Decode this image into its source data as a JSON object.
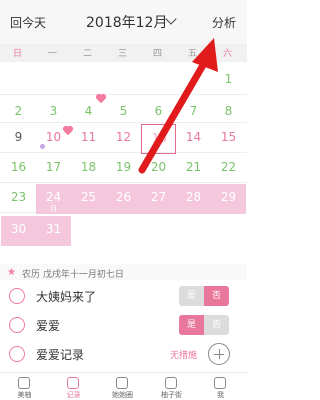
{
  "header": {
    "left_label": "回今天",
    "title": "2018年12月",
    "right_label": "分析"
  },
  "weekdays": [
    "日",
    "一",
    "二",
    "三",
    "四",
    "五",
    "六"
  ],
  "calendar": {
    "rows": [
      [
        {
          "label": "",
          "style": "empty"
        },
        {
          "label": "",
          "style": "empty"
        },
        {
          "label": "",
          "style": "empty"
        },
        {
          "label": "",
          "style": "empty"
        },
        {
          "label": "",
          "style": "empty"
        },
        {
          "label": "",
          "style": "empty"
        },
        {
          "label": "1",
          "style": "green"
        }
      ],
      [
        {
          "label": "2",
          "style": "green"
        },
        {
          "label": "3",
          "style": "green"
        },
        {
          "label": "4",
          "style": "green"
        },
        {
          "label": "5",
          "style": "green"
        },
        {
          "label": "6",
          "style": "green"
        },
        {
          "label": "7",
          "style": "green"
        },
        {
          "label": "8",
          "style": "green"
        }
      ],
      [
        {
          "label": "9",
          "style": "gray"
        },
        {
          "label": "10",
          "style": "pinktext"
        },
        {
          "label": "11",
          "style": "pinktext"
        },
        {
          "label": "12",
          "style": "pinktext"
        },
        {
          "label": "13",
          "style": "pinklight"
        },
        {
          "label": "14",
          "style": "pinktext"
        },
        {
          "label": "15",
          "style": "pinktext"
        }
      ],
      [
        {
          "label": "16",
          "style": "green"
        },
        {
          "label": "17",
          "style": "green"
        },
        {
          "label": "18",
          "style": "green"
        },
        {
          "label": "19",
          "style": "green"
        },
        {
          "label": "20",
          "style": "green"
        },
        {
          "label": "21",
          "style": "green"
        },
        {
          "label": "22",
          "style": "green"
        }
      ],
      [
        {
          "label": "23",
          "style": "green"
        },
        {
          "label": "24",
          "style": "pink",
          "sublabel": "月"
        },
        {
          "label": "25",
          "style": "pink"
        },
        {
          "label": "26",
          "style": "pink"
        },
        {
          "label": "27",
          "style": "pink"
        },
        {
          "label": "28",
          "style": "pink"
        },
        {
          "label": "29",
          "style": "pink"
        }
      ],
      [
        {
          "label": "30",
          "style": "pink"
        },
        {
          "label": "31",
          "style": "pink"
        },
        {
          "label": "",
          "style": "empty"
        },
        {
          "label": "",
          "style": "empty"
        },
        {
          "label": "",
          "style": "empty"
        },
        {
          "label": "",
          "style": "empty"
        },
        {
          "label": "",
          "style": "empty"
        }
      ]
    ],
    "selected_label": "13"
  },
  "info": {
    "lunar": "农历 戊戌年十一月初七日",
    "rows": [
      {
        "label": "大姨妈来了",
        "toggle": [
          "是",
          "否"
        ],
        "active": 1,
        "icon": "drop-icon"
      },
      {
        "label": "爱爱",
        "toggle": [
          "是",
          "否"
        ],
        "active": 0,
        "icon": "heart-icon"
      },
      {
        "label": "爱爱记录",
        "note": "无措施",
        "icon": "umbrella-icon"
      }
    ]
  },
  "bottom_tabs": [
    {
      "label": "美柚",
      "icon": "home-icon",
      "active": false
    },
    {
      "label": "记录",
      "icon": "calendar-icon",
      "active": true
    },
    {
      "label": "她她圈",
      "icon": "community-icon",
      "active": false
    },
    {
      "label": "柚子街",
      "icon": "shop-icon",
      "active": false
    },
    {
      "label": "我",
      "icon": "profile-icon",
      "active": false
    }
  ],
  "colors": {
    "accent_pink": "#e9779b",
    "period_pink": "#f5c7dc",
    "safe_green": "#7bc36a",
    "arrow_red": "#e11b1b"
  }
}
